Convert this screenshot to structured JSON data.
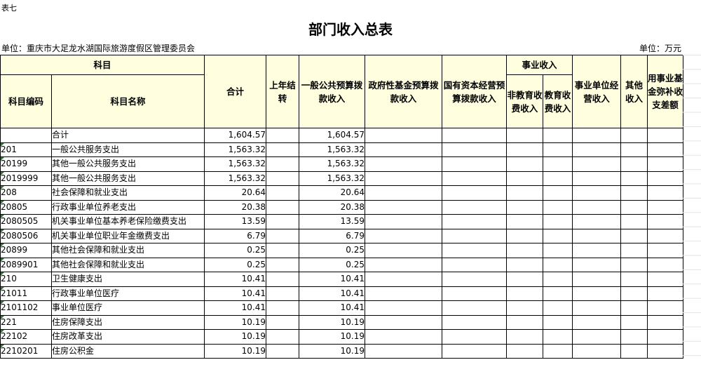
{
  "corner_label": "表七",
  "title": "部门收入总表",
  "unit_left": "单位：重庆市大足龙水湖国际旅游度假区管理委员会",
  "unit_right": "单位：万元",
  "headers": {
    "subject": "科目",
    "code": "科目编码",
    "name": "科目名称",
    "total": "合计",
    "carryover": "上年结转",
    "general": "一般公共预算拨款收入",
    "gov_fund": "政府性基金预算拨款收入",
    "state_capital": "国有资本经营预算拨款收入",
    "career": "事业收入",
    "non_edu": "非教育收费收入",
    "edu": "教育收费收入",
    "operating": "事业单位经营收入",
    "other": "其他收入",
    "compensate": "用事业基金弥补收支差额"
  },
  "rows": [
    {
      "code": "",
      "name": "合计",
      "total": "1,604.57",
      "general": "1,604.57"
    },
    {
      "code": "201",
      "name": "一般公共服务支出",
      "total": "1,563.32",
      "general": "1,563.32"
    },
    {
      "code": "20199",
      "name": "其他一般公共服务支出",
      "total": "1,563.32",
      "general": "1,563.32"
    },
    {
      "code": "2019999",
      "name": "其他一般公共服务支出",
      "total": "1,563.32",
      "general": "1,563.32"
    },
    {
      "code": "208",
      "name": "社会保障和就业支出",
      "total": "20.64",
      "general": "20.64"
    },
    {
      "code": "20805",
      "name": "行政事业单位养老支出",
      "total": "20.38",
      "general": "20.38"
    },
    {
      "code": "2080505",
      "name": "机关事业单位基本养老保险缴费支出",
      "total": "13.59",
      "general": "13.59"
    },
    {
      "code": "2080506",
      "name": "机关事业单位职业年金缴费支出",
      "total": "6.79",
      "general": "6.79"
    },
    {
      "code": "20899",
      "name": "其他社会保障和就业支出",
      "total": "0.25",
      "general": "0.25"
    },
    {
      "code": "2089901",
      "name": "其他社会保障和就业支出",
      "total": "0.25",
      "general": "0.25"
    },
    {
      "code": "210",
      "name": "卫生健康支出",
      "total": "10.41",
      "general": "10.41"
    },
    {
      "code": "21011",
      "name": "行政事业单位医疗",
      "total": "10.41",
      "general": "10.41"
    },
    {
      "code": "2101102",
      "name": "事业单位医疗",
      "total": "10.41",
      "general": "10.41"
    },
    {
      "code": "221",
      "name": "住房保障支出",
      "total": "10.19",
      "general": "10.19"
    },
    {
      "code": "22102",
      "name": "住房改革支出",
      "total": "10.19",
      "general": "10.19"
    },
    {
      "code": "2210201",
      "name": "住房公积金",
      "total": "10.19",
      "general": "10.19"
    }
  ]
}
